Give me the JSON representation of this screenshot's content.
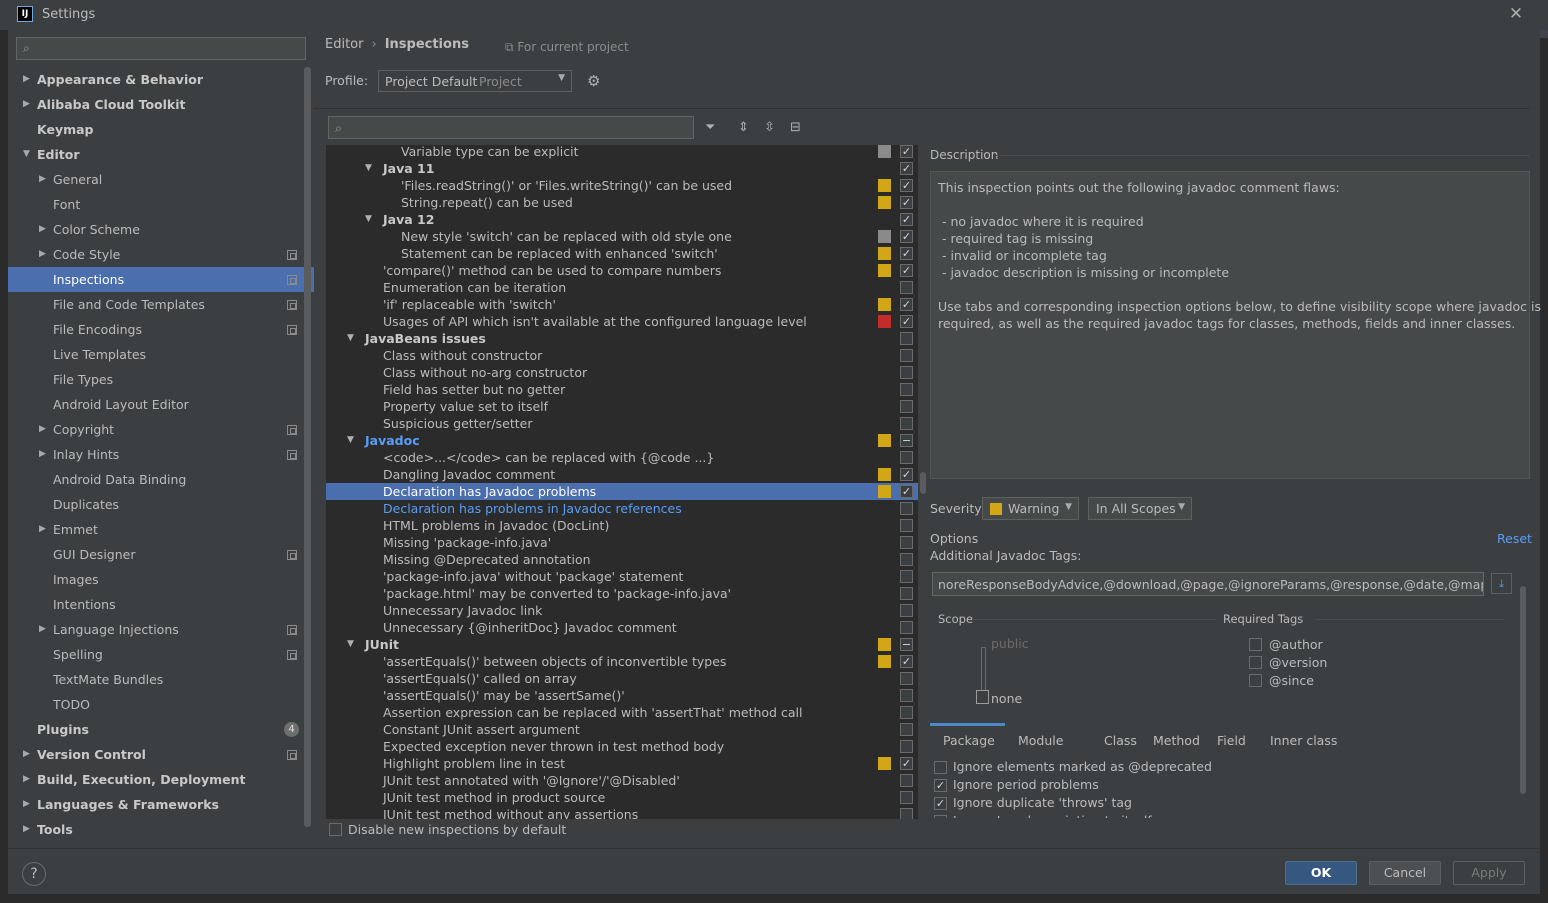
{
  "window": {
    "title": "Settings",
    "icon_text": "IJ"
  },
  "sidebar": {
    "search_placeholder": "",
    "items": [
      {
        "label": "Appearance & Behavior",
        "level": 0,
        "arrow": "right",
        "bold": true
      },
      {
        "label": "Alibaba Cloud Toolkit",
        "level": 0,
        "arrow": "right",
        "bold": true
      },
      {
        "label": "Keymap",
        "level": 0,
        "arrow": "",
        "bold": true
      },
      {
        "label": "Editor",
        "level": 0,
        "arrow": "down",
        "bold": true
      },
      {
        "label": "General",
        "level": 1,
        "arrow": "right"
      },
      {
        "label": "Font",
        "level": 1,
        "arrow": ""
      },
      {
        "label": "Color Scheme",
        "level": 1,
        "arrow": "right"
      },
      {
        "label": "Code Style",
        "level": 1,
        "arrow": "right",
        "copy": true
      },
      {
        "label": "Inspections",
        "level": 1,
        "arrow": "",
        "copy": true,
        "selected": true
      },
      {
        "label": "File and Code Templates",
        "level": 1,
        "arrow": "",
        "copy": true
      },
      {
        "label": "File Encodings",
        "level": 1,
        "arrow": "",
        "copy": true
      },
      {
        "label": "Live Templates",
        "level": 1,
        "arrow": ""
      },
      {
        "label": "File Types",
        "level": 1,
        "arrow": ""
      },
      {
        "label": "Android Layout Editor",
        "level": 1,
        "arrow": ""
      },
      {
        "label": "Copyright",
        "level": 1,
        "arrow": "right",
        "copy": true
      },
      {
        "label": "Inlay Hints",
        "level": 1,
        "arrow": "right",
        "copy": true
      },
      {
        "label": "Android Data Binding",
        "level": 1,
        "arrow": ""
      },
      {
        "label": "Duplicates",
        "level": 1,
        "arrow": ""
      },
      {
        "label": "Emmet",
        "level": 1,
        "arrow": "right"
      },
      {
        "label": "GUI Designer",
        "level": 1,
        "arrow": "",
        "copy": true
      },
      {
        "label": "Images",
        "level": 1,
        "arrow": ""
      },
      {
        "label": "Intentions",
        "level": 1,
        "arrow": ""
      },
      {
        "label": "Language Injections",
        "level": 1,
        "arrow": "right",
        "copy": true
      },
      {
        "label": "Spelling",
        "level": 1,
        "arrow": "",
        "copy": true
      },
      {
        "label": "TextMate Bundles",
        "level": 1,
        "arrow": ""
      },
      {
        "label": "TODO",
        "level": 1,
        "arrow": ""
      },
      {
        "label": "Plugins",
        "level": 0,
        "arrow": "",
        "bold": true,
        "badge": "4"
      },
      {
        "label": "Version Control",
        "level": 0,
        "arrow": "right",
        "bold": true,
        "copy": true
      },
      {
        "label": "Build, Execution, Deployment",
        "level": 0,
        "arrow": "right",
        "bold": true
      },
      {
        "label": "Languages & Frameworks",
        "level": 0,
        "arrow": "right",
        "bold": true
      },
      {
        "label": "Tools",
        "level": 0,
        "arrow": "right",
        "bold": true
      }
    ]
  },
  "header": {
    "breadcrumb": [
      "Editor",
      "Inspections"
    ],
    "for_project": "For current project",
    "profile_label": "Profile:",
    "profile_value": "Project Default",
    "profile_sub": "Project"
  },
  "inspections": {
    "search_placeholder": "",
    "rows": [
      {
        "text": "Variable type can be explicit",
        "indent": 3,
        "sev": "gray",
        "chk": "on"
      },
      {
        "text": "Java 11",
        "indent": 2,
        "group": true,
        "arrow": "down",
        "chk": "on"
      },
      {
        "text": "'Files.readString()' or 'Files.writeString()' can be used",
        "indent": 3,
        "sev": "yellow",
        "chk": "on"
      },
      {
        "text": "String.repeat() can be used",
        "indent": 3,
        "sev": "yellow",
        "chk": "on"
      },
      {
        "text": "Java 12",
        "indent": 2,
        "group": true,
        "arrow": "down",
        "chk": "on"
      },
      {
        "text": "New style 'switch' can be replaced with old style one",
        "indent": 3,
        "sev": "gray",
        "chk": "on"
      },
      {
        "text": "Statement can be replaced with enhanced 'switch'",
        "indent": 3,
        "sev": "yellow",
        "chk": "on"
      },
      {
        "text": "'compare()' method can be used to compare numbers",
        "indent": 2,
        "sev": "yellow",
        "chk": "on"
      },
      {
        "text": "Enumeration can be iteration",
        "indent": 2,
        "chk": "off"
      },
      {
        "text": "'if' replaceable with 'switch'",
        "indent": 2,
        "sev": "yellow",
        "chk": "on"
      },
      {
        "text": "Usages of API which isn't available at the configured language level",
        "indent": 2,
        "sev": "red",
        "chk": "on"
      },
      {
        "text": "JavaBeans issues",
        "indent": 1,
        "group": true,
        "arrow": "down",
        "chk": "off"
      },
      {
        "text": "Class without constructor",
        "indent": 2,
        "chk": "off"
      },
      {
        "text": "Class without no-arg constructor",
        "indent": 2,
        "chk": "off"
      },
      {
        "text": "Field has setter but no getter",
        "indent": 2,
        "chk": "off"
      },
      {
        "text": "Property value set to itself",
        "indent": 2,
        "chk": "off"
      },
      {
        "text": "Suspicious getter/setter",
        "indent": 2,
        "chk": "off"
      },
      {
        "text": "Javadoc",
        "indent": 1,
        "group": true,
        "arrow": "down",
        "link": true,
        "sev": "yellow",
        "chk": "partial"
      },
      {
        "text": "<code>...</code> can be replaced with {@code ...}",
        "indent": 2,
        "chk": "off"
      },
      {
        "text": "Dangling Javadoc comment",
        "indent": 2,
        "sev": "yellow",
        "chk": "on"
      },
      {
        "text": "Declaration has Javadoc problems",
        "indent": 2,
        "sev": "yellow",
        "chk": "on",
        "selected": true
      },
      {
        "text": "Declaration has problems in Javadoc references",
        "indent": 2,
        "link": true,
        "chk": "off"
      },
      {
        "text": "HTML problems in Javadoc (DocLint)",
        "indent": 2,
        "chk": "off"
      },
      {
        "text": "Missing 'package-info.java'",
        "indent": 2,
        "chk": "off"
      },
      {
        "text": "Missing @Deprecated annotation",
        "indent": 2,
        "chk": "off"
      },
      {
        "text": "'package-info.java' without 'package' statement",
        "indent": 2,
        "chk": "off"
      },
      {
        "text": "'package.html' may be converted to 'package-info.java'",
        "indent": 2,
        "chk": "off"
      },
      {
        "text": "Unnecessary Javadoc link",
        "indent": 2,
        "chk": "off"
      },
      {
        "text": "Unnecessary {@inheritDoc} Javadoc comment",
        "indent": 2,
        "chk": "off"
      },
      {
        "text": "JUnit",
        "indent": 1,
        "group": true,
        "arrow": "down",
        "sev": "yellow",
        "chk": "partial"
      },
      {
        "text": "'assertEquals()' between objects of inconvertible types",
        "indent": 2,
        "sev": "yellow",
        "chk": "on"
      },
      {
        "text": "'assertEquals()' called on array",
        "indent": 2,
        "chk": "off"
      },
      {
        "text": "'assertEquals()' may be 'assertSame()'",
        "indent": 2,
        "chk": "off"
      },
      {
        "text": "Assertion expression can be replaced with 'assertThat' method call",
        "indent": 2,
        "chk": "off"
      },
      {
        "text": "Constant JUnit assert argument",
        "indent": 2,
        "chk": "off"
      },
      {
        "text": "Expected exception never thrown in test method body",
        "indent": 2,
        "chk": "off"
      },
      {
        "text": "Highlight problem line in test",
        "indent": 2,
        "sev": "yellow",
        "chk": "on"
      },
      {
        "text": "JUnit test annotated with '@Ignore'/'@Disabled'",
        "indent": 2,
        "chk": "off"
      },
      {
        "text": "JUnit test method in product source",
        "indent": 2,
        "chk": "off"
      },
      {
        "text": "JUnit test method without any assertions",
        "indent": 2,
        "chk": "off"
      }
    ],
    "disable_new": "Disable new inspections by default"
  },
  "description": {
    "label": "Description",
    "text": "This inspection points out the following javadoc comment flaws:\n\n - no javadoc where it is required\n - required tag is missing\n - invalid or incomplete tag\n - javadoc description is missing or incomplete\n\nUse tabs and corresponding inspection options below, to define visibility scope where javadoc is\nrequired, as well as the required javadoc tags for classes, methods, fields and inner classes."
  },
  "severity": {
    "label": "Severity:",
    "value": "Warning",
    "scope": "In All Scopes"
  },
  "options": {
    "label": "Options",
    "reset": "Reset",
    "additional_tags_label": "Additional Javadoc Tags:",
    "additional_tags_value": "noreResponseBodyAdvice,@download,@page,@ignoreParams,@response,@date,@mapDto",
    "scope_label": "Scope",
    "required_tags_label": "Required Tags",
    "scope_public": "public",
    "scope_none": "none",
    "required_tags": [
      "@author",
      "@version",
      "@since"
    ],
    "tabs": [
      "Package",
      "Module",
      "Class",
      "Method",
      "Field",
      "Inner class"
    ],
    "checks": [
      {
        "label": "Ignore elements marked as @deprecated",
        "checked": false
      },
      {
        "label": "Ignore period problems",
        "checked": true
      },
      {
        "label": "Ignore duplicate 'throws' tag",
        "checked": true
      },
      {
        "label": "Ignore Javadoc pointing to itself",
        "checked": false
      }
    ]
  },
  "buttons": {
    "ok": "OK",
    "cancel": "Cancel",
    "apply": "Apply",
    "help": "?"
  },
  "colors": {
    "accent": "#4b6eaf",
    "warning": "#d1a617",
    "error": "#c42b2b",
    "weak": "#8a8a8a",
    "link": "#589df6"
  }
}
